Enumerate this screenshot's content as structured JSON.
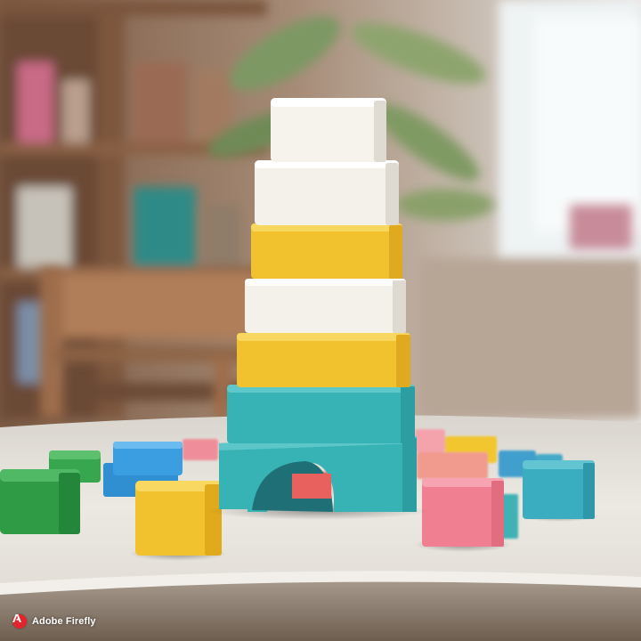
{
  "scene": {
    "description_colors": {
      "block_white": "#f4f1ea",
      "block_yellow": "#f2c12e",
      "block_teal": "#38b3b5",
      "block_green": "#2f9b45",
      "block_blue": "#3b9bd4",
      "block_pink": "#ef7b8c",
      "table_top": "#e9e6e0",
      "wood": "#a8724a"
    }
  },
  "watermark": {
    "label": "Adobe Firefly",
    "logo_icon": "adobe-logo-icon",
    "logo_color": "#e3242b"
  }
}
